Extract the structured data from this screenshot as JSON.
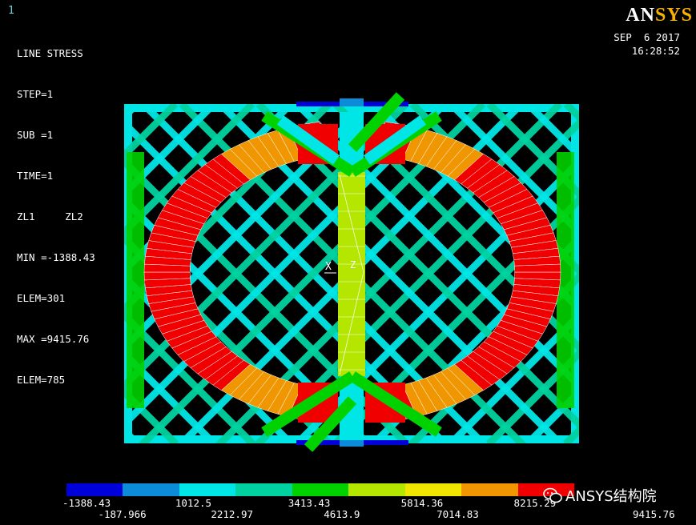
{
  "window_number": "1",
  "info": {
    "title": "LINE STRESS",
    "step": "STEP=1",
    "sub": "SUB =1",
    "time": "TIME=1",
    "elements": "ZL1     ZL2",
    "min": "MIN =-1388.43",
    "min_elem": "ELEM=301",
    "max": "MAX =9415.76",
    "max_elem": "ELEM=785"
  },
  "logo": {
    "a": "AN",
    "b": "SYS"
  },
  "date": "SEP  6 2017",
  "time_of_day": "16:28:52",
  "axis_label": "X",
  "axis_label_z": "Z",
  "legend": {
    "colors": [
      "#0000d8",
      "#0c8cd8",
      "#00e6e6",
      "#00d2a0",
      "#00d200",
      "#b4e600",
      "#f0e600",
      "#f09600",
      "#f00000"
    ],
    "ticks_top": [
      "-1388.43",
      "1012.5",
      "3413.43",
      "5814.36",
      "8215.29"
    ],
    "ticks_bottom": [
      "-187.966",
      "2212.97",
      "4613.9",
      "7014.83",
      "9415.76"
    ]
  },
  "watermark": "ANSYS结构院"
}
